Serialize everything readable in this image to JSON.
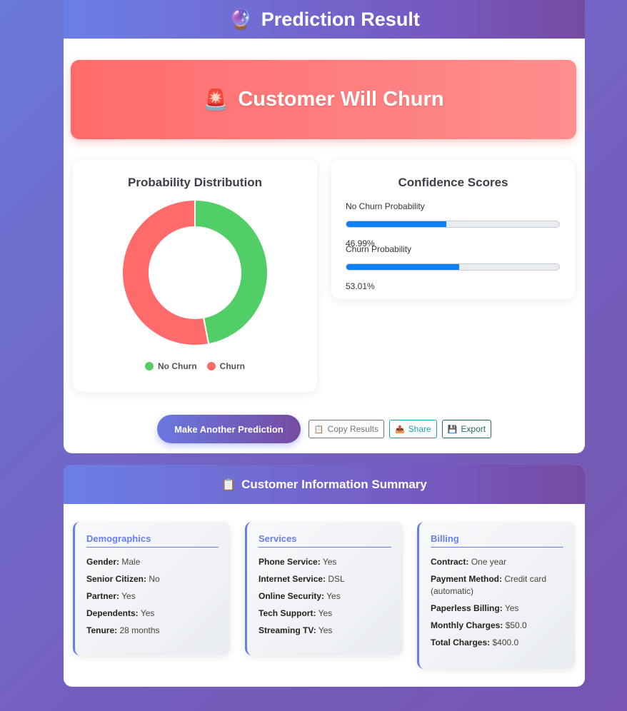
{
  "result": {
    "header_icon": "crystal-ball",
    "title": "Prediction Result",
    "banner_icon": "rotating-light",
    "banner_text": "Customer Will Churn"
  },
  "distribution": {
    "title": "Probability Distribution",
    "legend": [
      "No Churn",
      "Churn"
    ]
  },
  "confidence": {
    "title": "Confidence Scores",
    "items": [
      {
        "label": "No Churn Probability",
        "value": "46.99%",
        "fraction": 0.4699
      },
      {
        "label": "Churn Probability",
        "value": "53.01%",
        "fraction": 0.5301
      }
    ]
  },
  "chart_data": {
    "type": "pie",
    "categories": [
      "No Churn",
      "Churn"
    ],
    "values": [
      46.99,
      53.01
    ],
    "colors": [
      "#51cf66",
      "#ff6b6b"
    ],
    "donut": true,
    "title": "Probability Distribution",
    "legend": "bottom"
  },
  "actions": {
    "primary": "Make Another Prediction",
    "copy": "Copy Results",
    "copy_icon": "clipboard",
    "share": "Share",
    "share_icon": "outbox",
    "export": "Export",
    "export_icon": "floppy-disk"
  },
  "summary": {
    "header_icon": "clipboard",
    "title": "Customer Information Summary",
    "demographics": {
      "title": "Demographics",
      "rows": [
        {
          "k": "Gender:",
          "v": "Male"
        },
        {
          "k": "Senior Citizen:",
          "v": "No"
        },
        {
          "k": "Partner:",
          "v": "Yes"
        },
        {
          "k": "Dependents:",
          "v": "Yes"
        },
        {
          "k": "Tenure:",
          "v": "28 months"
        }
      ]
    },
    "services": {
      "title": "Services",
      "rows": [
        {
          "k": "Phone Service:",
          "v": "Yes"
        },
        {
          "k": "Internet Service:",
          "v": "DSL"
        },
        {
          "k": "Online Security:",
          "v": "Yes"
        },
        {
          "k": "Tech Support:",
          "v": "Yes"
        },
        {
          "k": "Streaming TV:",
          "v": "Yes"
        }
      ]
    },
    "billing": {
      "title": "Billing",
      "rows": [
        {
          "k": "Contract:",
          "v": "One year"
        },
        {
          "k": "Payment Method:",
          "v": "Credit card (automatic)"
        },
        {
          "k": "Paperless Billing:",
          "v": "Yes"
        },
        {
          "k": "Monthly Charges:",
          "v": "$50.0"
        },
        {
          "k": "Total Charges:",
          "v": "$400.0"
        }
      ]
    }
  },
  "colors": {
    "accent": "#667eea",
    "accent_end": "#764ba2",
    "churn": "#ff6b6b",
    "no_churn": "#51cf66",
    "progress": "#0d7ff5"
  }
}
